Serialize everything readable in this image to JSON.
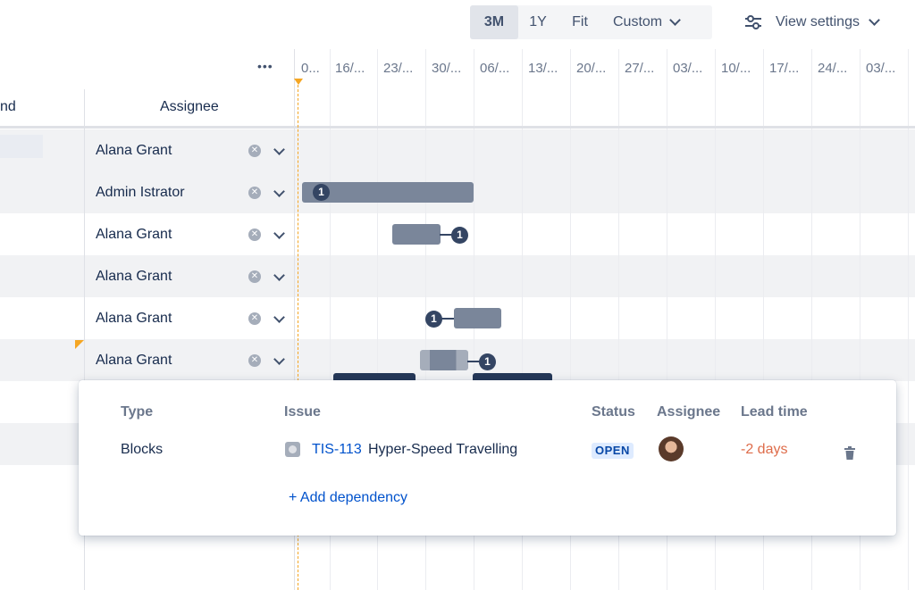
{
  "toolbar": {
    "ranges": [
      "3M",
      "1Y",
      "Fit",
      "Custom"
    ],
    "active_range": "3M",
    "view_settings_label": "View settings"
  },
  "columns": {
    "left_partial": "nd",
    "assignee": "Assignee",
    "more": "•••"
  },
  "timeline": {
    "ticks": [
      "0...",
      "16/...",
      "23/...",
      "30/...",
      "06/...",
      "13/...",
      "20/...",
      "27/...",
      "03/...",
      "10/...",
      "17/...",
      "24/...",
      "03/..."
    ]
  },
  "rows": [
    {
      "assignee": "Alana Grant"
    },
    {
      "assignee": "Admin Istrator"
    },
    {
      "assignee": "Alana Grant"
    },
    {
      "assignee": "Alana Grant"
    },
    {
      "assignee": "Alana Grant"
    },
    {
      "assignee": "Alana Grant"
    }
  ],
  "badges": {
    "count": "1"
  },
  "popup": {
    "headers": {
      "type": "Type",
      "issue": "Issue",
      "status": "Status",
      "assignee": "Assignee",
      "lead_time": "Lead time"
    },
    "dependency": {
      "type": "Blocks",
      "issue_key": "TIS-113",
      "issue_summary": "Hyper-Speed Travelling",
      "status": "OPEN",
      "lead_time": "-2 days"
    },
    "add_dependency": "+ Add dependency"
  },
  "colors": {
    "link": "#0052cc",
    "lead_time": "#de6c4a",
    "status_bg": "#deebff",
    "bar": "#7a869a",
    "today_line": "#f5a623"
  }
}
